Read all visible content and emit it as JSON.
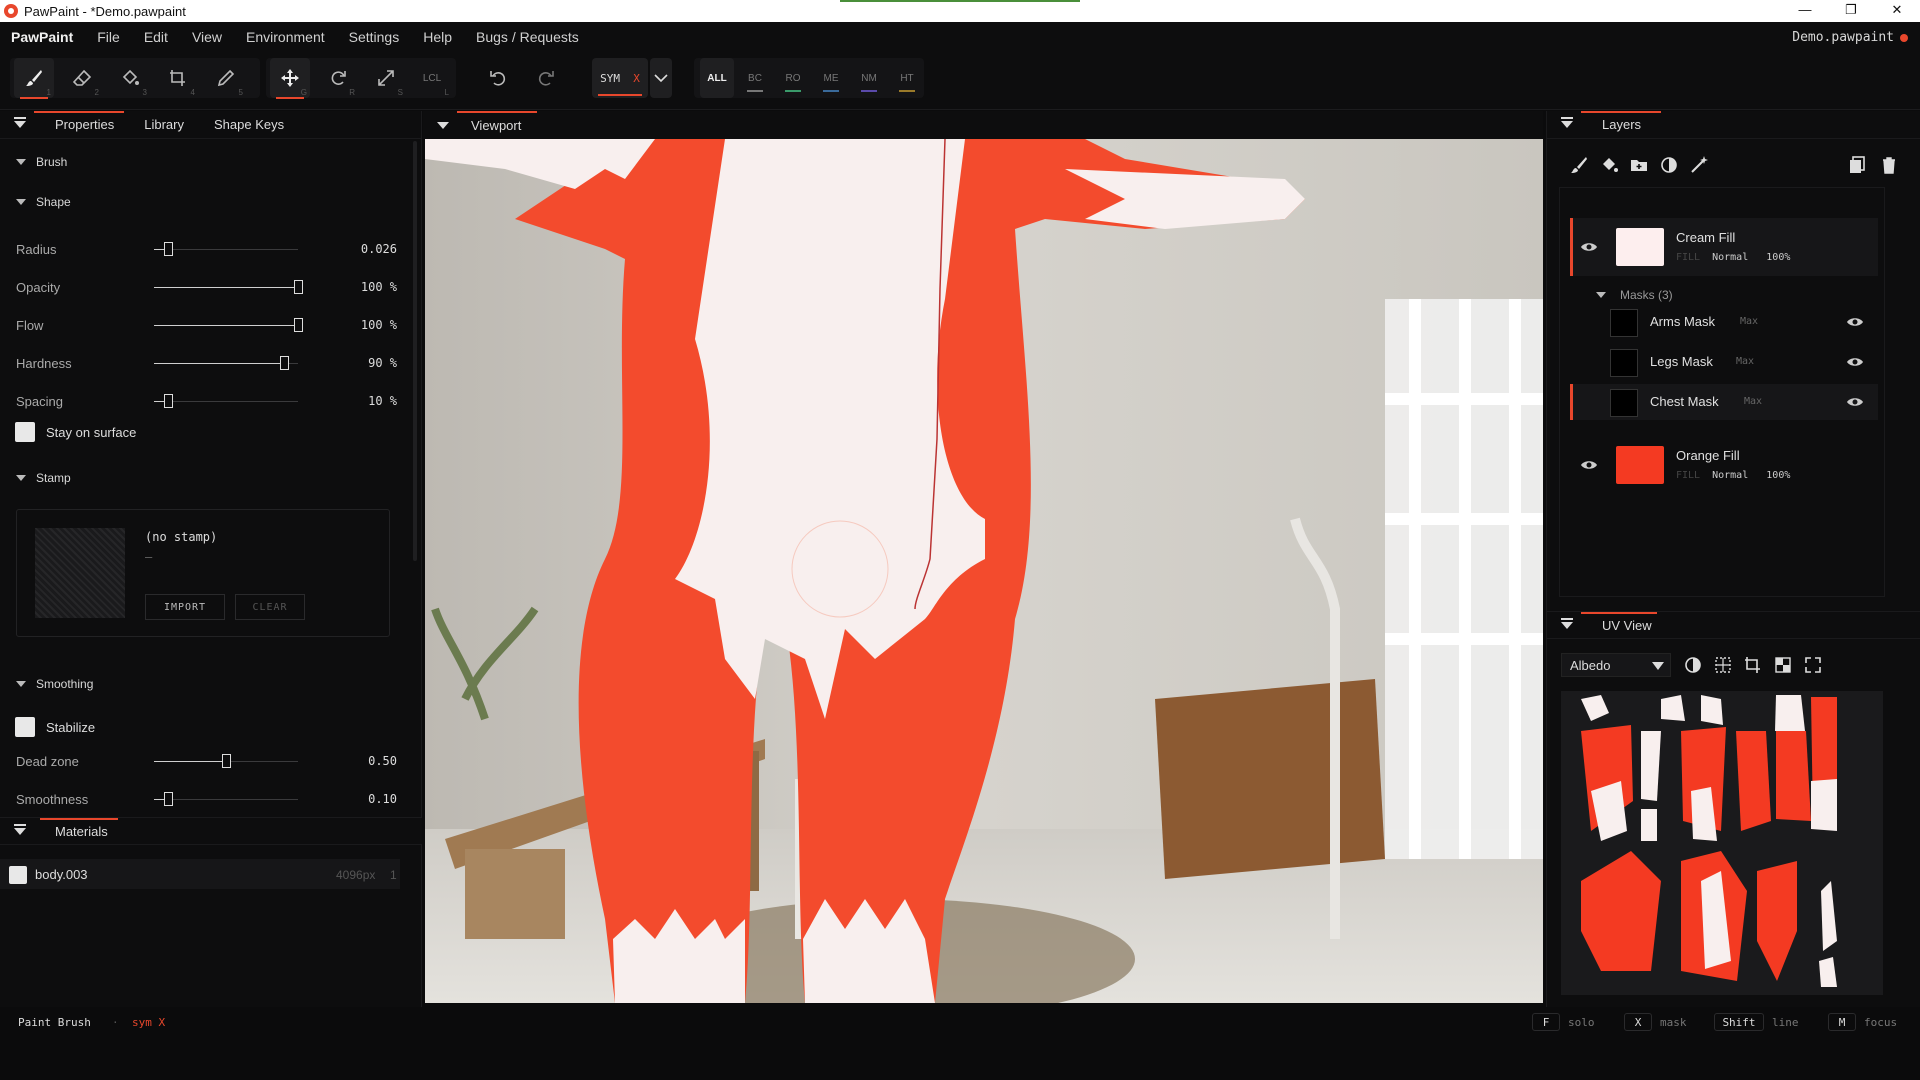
{
  "window": {
    "title": "PawPaint - *Demo.pawpaint",
    "controls": [
      "—",
      "❐",
      "✕"
    ]
  },
  "menubar": {
    "brand": "PawPaint",
    "items": [
      "File",
      "Edit",
      "View",
      "Environment",
      "Settings",
      "Help",
      "Bugs / Requests"
    ],
    "file": "Demo.pawpaint"
  },
  "toolbar": {
    "tools": [
      {
        "name": "brush",
        "key": "1"
      },
      {
        "name": "eraser",
        "key": "2"
      },
      {
        "name": "fill",
        "key": "3"
      },
      {
        "name": "smudge",
        "key": "4"
      },
      {
        "name": "picker",
        "key": "5"
      },
      {
        "name": "move",
        "key": "G"
      },
      {
        "name": "rotate",
        "key": "R"
      },
      {
        "name": "scale",
        "key": "S"
      },
      {
        "name": "local",
        "key": "L",
        "label": "LCL"
      }
    ],
    "sym": {
      "label": "SYM",
      "axis": "X"
    },
    "channels": [
      {
        "label": "ALL",
        "color": ""
      },
      {
        "label": "BC",
        "color": "#777777"
      },
      {
        "label": "RO",
        "color": "#3a9a6a"
      },
      {
        "label": "ME",
        "color": "#3a6a9a"
      },
      {
        "label": "NM",
        "color": "#5a4aaa"
      },
      {
        "label": "HT",
        "color": "#9a7a2a"
      }
    ]
  },
  "left_panel": {
    "tabs": [
      "Properties",
      "Library",
      "Shape Keys"
    ],
    "brush_section": "Brush",
    "shape_section": "Shape",
    "sliders": [
      {
        "label": "Radius",
        "value": "0.026",
        "fraction": 0.1
      },
      {
        "label": "Opacity",
        "value": "100 %",
        "fraction": 1.0
      },
      {
        "label": "Flow",
        "value": "100 %",
        "fraction": 1.0
      },
      {
        "label": "Hardness",
        "value": "90 %",
        "fraction": 0.9
      },
      {
        "label": "Spacing",
        "value": "10 %",
        "fraction": 0.1
      }
    ],
    "stay_on_surface": "Stay on surface",
    "stamp_section": "Stamp",
    "stamp": {
      "name": "(no stamp)",
      "sub": "–",
      "import": "IMPORT",
      "clear": "CLEAR"
    },
    "smoothing_section": "Smoothing",
    "stabilize": "Stabilize",
    "smoothing_sliders": [
      {
        "label": "Dead zone",
        "value": "0.50",
        "fraction": 0.5
      },
      {
        "label": "Smoothness",
        "value": "0.10",
        "fraction": 0.1
      }
    ],
    "materials_header": "Materials",
    "materials": [
      {
        "name": "body.003",
        "info": "4096px",
        "count": "1"
      }
    ]
  },
  "viewport": {
    "header": "Viewport"
  },
  "layers_panel": {
    "header": "Layers",
    "layers": [
      {
        "name": "Cream Fill",
        "type": "FILL",
        "blend": "Normal",
        "opacity": "100%",
        "color": "#fdeeee"
      },
      {
        "name": "Orange Fill",
        "type": "FILL",
        "blend": "Normal",
        "opacity": "100%",
        "color": "#f43a22"
      }
    ],
    "masks_label": "Masks (3)",
    "masks": [
      {
        "name": "Arms Mask",
        "mode": "Max"
      },
      {
        "name": "Legs Mask",
        "mode": "Max"
      },
      {
        "name": "Chest Mask",
        "mode": "Max"
      }
    ]
  },
  "uv_panel": {
    "header": "UV View",
    "channel": "Albedo"
  },
  "statusbar": {
    "tool": "Paint Brush",
    "sep": "·",
    "sym": "sym X",
    "hints": [
      {
        "key": "F",
        "desc": "solo"
      },
      {
        "key": "X",
        "desc": "mask"
      },
      {
        "key": "Shift",
        "desc": "line"
      },
      {
        "key": "M",
        "desc": "focus"
      }
    ]
  },
  "colors": {
    "accent": "#e8472c",
    "orange": "#f43a22",
    "cream": "#fdeeee"
  }
}
